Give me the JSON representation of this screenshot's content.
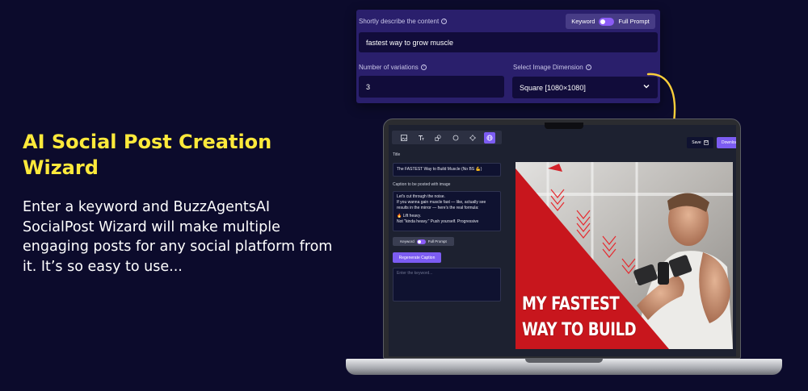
{
  "hero": {
    "title": "AI Social Post Creation Wizard",
    "description": "Enter a keyword and BuzzAgentsAI SocialPost Wizard will make multiple engaging posts for any social platform from it. It’s so easy to use..."
  },
  "form": {
    "content_label": "Shortly describe the content",
    "toggle_left": "Keyword",
    "toggle_right": "Full Prompt",
    "content_value": "fastest way to grow muscle",
    "variations_label": "Number of variations",
    "variations_value": "3",
    "dimension_label": "Select Image Dimension",
    "dimension_value": "Square [1080×1080]"
  },
  "app": {
    "title_label": "Title",
    "title_value": "The FASTEST Way to Build Muscle (No BS 💪)",
    "caption_label": "Caption to be posted with image",
    "caption_lines": [
      "Let's cut through the noise.",
      "If you wanna gain muscle fast — like, actually see",
      "results in the mirror — here's the real formula:",
      "",
      "🔥 Lift heavy.",
      "Not \"kinda heavy.\" Push yourself. Progressive"
    ],
    "toggle_left": "Keyword",
    "toggle_right": "Full Prompt",
    "regenerate_label": "Regenerate Caption",
    "keyword_placeholder": "Enter the keyword...",
    "save_label": "Save",
    "download_label": "Download",
    "preview_line1": "MY FASTEST",
    "preview_line2": "WAY TO BUILD"
  },
  "colors": {
    "background": "#0c0b2c",
    "accent_yellow": "#fde93b",
    "accent_purple": "#7c5cf2",
    "form_panel": "#2a1f6c",
    "poster_red": "#c8161d"
  },
  "icons": [
    "help-icon",
    "chevron-down-icon",
    "image-icon",
    "text-icon",
    "shapes-icon",
    "circle-icon",
    "target-icon",
    "globe-icon",
    "save-icon"
  ]
}
